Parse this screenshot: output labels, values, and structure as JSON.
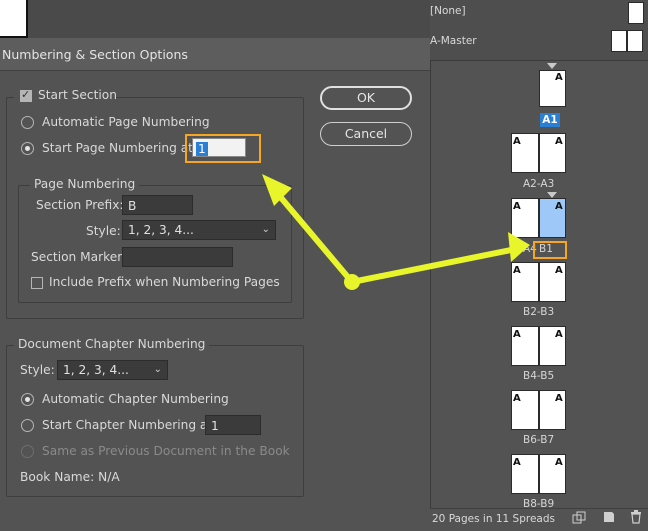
{
  "dialog": {
    "title": "Numbering & Section Options",
    "ok_label": "OK",
    "cancel_label": "Cancel",
    "start_section": {
      "label": "Start Section",
      "checked": true
    },
    "auto_page_numbering": "Automatic Page Numbering",
    "start_page_numbering_at": "Start Page Numbering at:",
    "start_page_value": "1",
    "page_numbering": {
      "legend": "Page Numbering",
      "section_prefix_label": "Section Prefix:",
      "section_prefix_value": "B",
      "style_label": "Style:",
      "style_value": "1, 2, 3, 4...",
      "section_marker_label": "Section Marker:",
      "section_marker_value": "",
      "include_prefix_label": "Include Prefix when Numbering Pages"
    },
    "chapter": {
      "legend": "Document Chapter Numbering",
      "style_label": "Style:",
      "style_value": "1, 2, 3, 4...",
      "auto_label": "Automatic Chapter Numbering",
      "start_label": "Start Chapter Numbering at:",
      "start_value": "1",
      "same_as_prev_label": "Same as Previous Document in the Book",
      "book_name": "Book Name: N/A"
    }
  },
  "pages_panel": {
    "masters": [
      {
        "name": "[None]"
      },
      {
        "name": "A-Master"
      }
    ],
    "page_labels": {
      "a1": "A1",
      "a2a3": "A2-A3",
      "a4": "A4",
      "b1": "B1",
      "b2b3": "B2-B3",
      "b4b5": "B4-B5",
      "b6b7": "B6-B7",
      "b8b9": "B8-B9"
    },
    "letter_a": "A",
    "footer_text": "20 Pages in 11 Spreads"
  },
  "colors": {
    "highlight": "#f5a623",
    "annotation_arrow": "#e8f52a",
    "page_selected": "#9ec8f7",
    "label_selected": "#2a7fd4"
  }
}
